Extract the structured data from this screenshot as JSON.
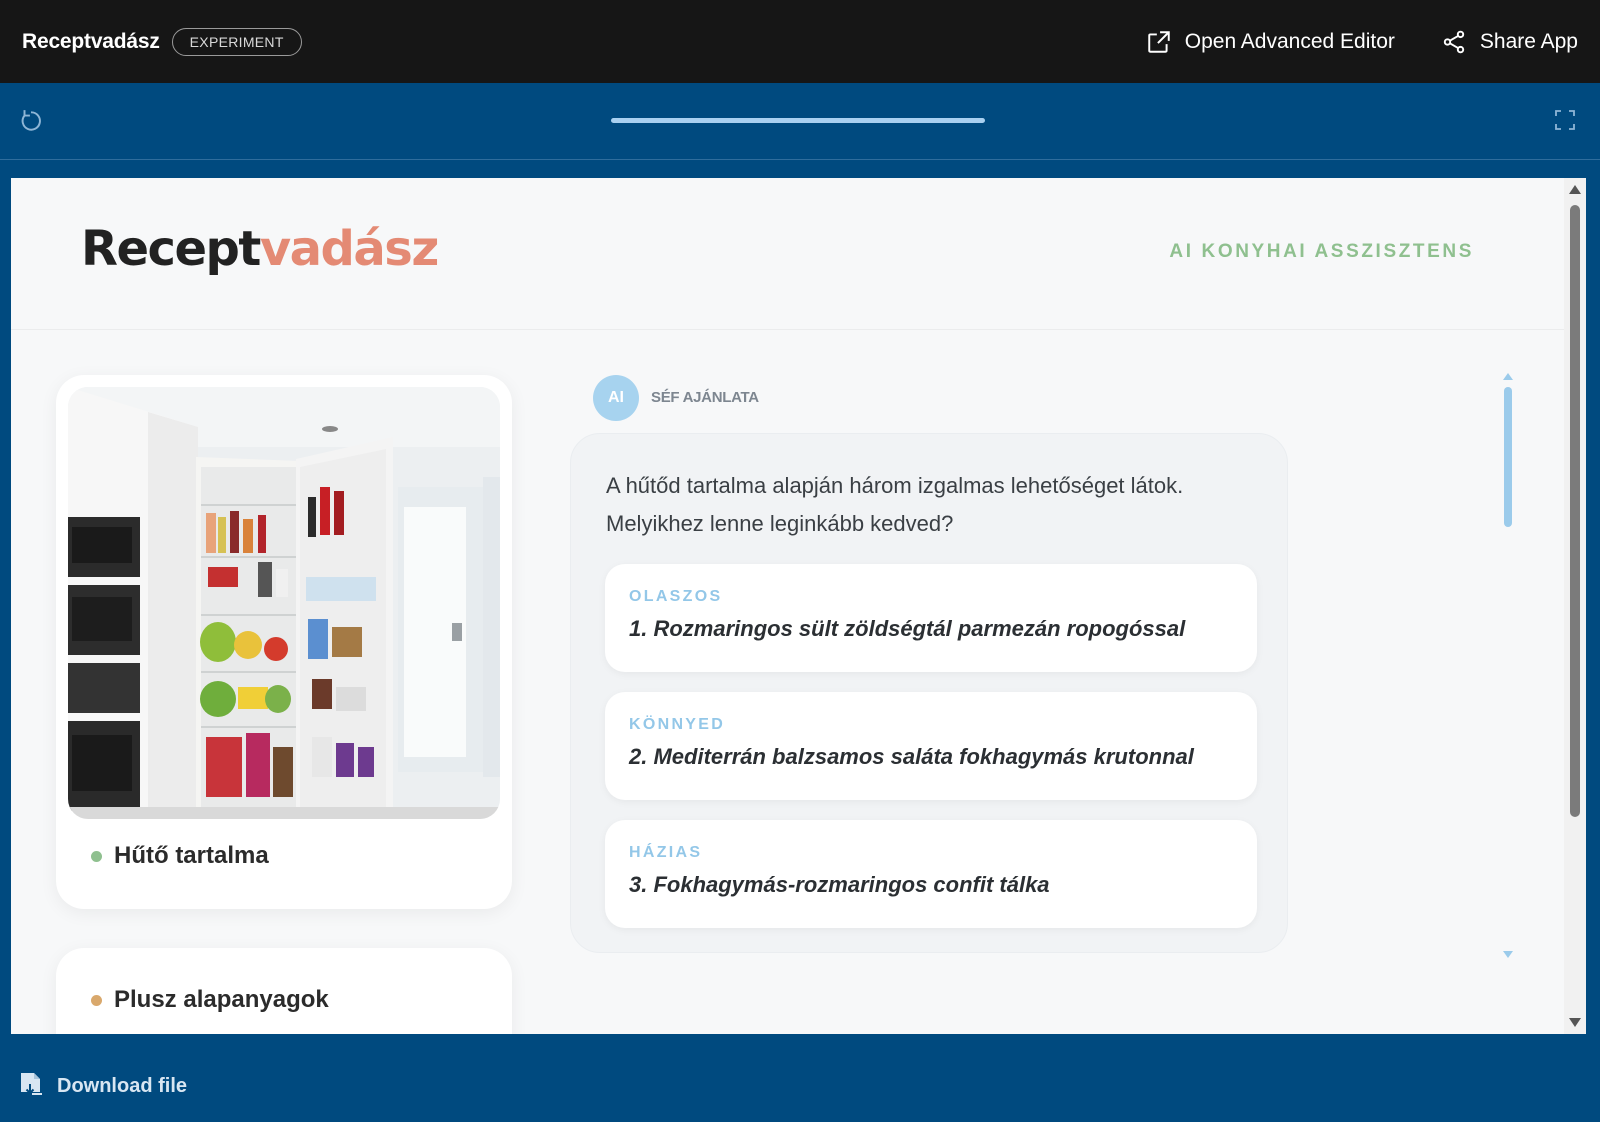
{
  "topbar": {
    "app_title": "Receptvadász",
    "badge": "EXPERIMENT",
    "open_editor": "Open Advanced Editor",
    "share": "Share App"
  },
  "toolbar": {
    "progress": 1.0
  },
  "app": {
    "logo_part1": "Recept",
    "logo_part2": "vadász",
    "tagline": "AI KONYHAI ASSZISZTENS",
    "colors": {
      "accent": "#e48a74",
      "green": "#8fc08f",
      "blue": "#93c7e8"
    }
  },
  "left": {
    "fridge_label": "Hűtő tartalma",
    "extra_label": "Plusz alapanyagok"
  },
  "chat": {
    "avatar": "AI",
    "sender": "SÉF AJÁNLATA",
    "message": "A hűtőd tartalma alapján három izgalmas lehetőséget látok. Melyikhez lenne leginkább kedved?",
    "options": [
      {
        "category": "OLASZOS",
        "title": "1. Rozmaringos sült zöldségtál parmezán ropogóssal"
      },
      {
        "category": "KÖNNYED",
        "title": "2. Mediterrán balzsamos saláta fokhagymás krutonnal"
      },
      {
        "category": "HÁZIAS",
        "title": "3. Fokhagymás-rozmaringos confit tálka"
      }
    ]
  },
  "footer": {
    "download": "Download file"
  }
}
